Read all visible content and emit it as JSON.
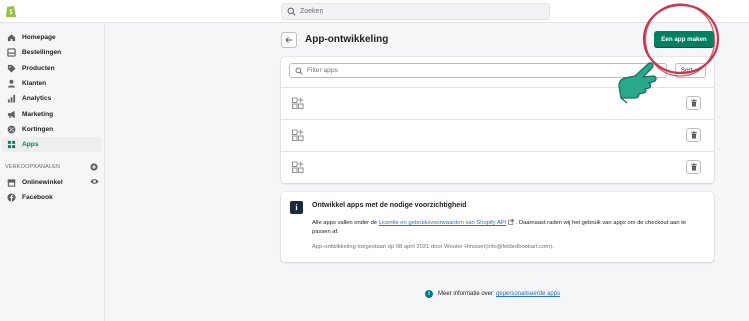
{
  "topbar": {
    "search_placeholder": "Zoeken"
  },
  "sidebar": {
    "items": [
      {
        "label": "Homepage",
        "icon": "home-icon"
      },
      {
        "label": "Bestellingen",
        "icon": "orders-icon"
      },
      {
        "label": "Producten",
        "icon": "tag-icon"
      },
      {
        "label": "Klanten",
        "icon": "person-icon"
      },
      {
        "label": "Analytics",
        "icon": "analytics-icon"
      },
      {
        "label": "Marketing",
        "icon": "megaphone-icon"
      },
      {
        "label": "Kortingen",
        "icon": "discount-icon"
      },
      {
        "label": "Apps",
        "icon": "apps-icon",
        "active": true
      }
    ],
    "section_title": "VERKOOPKANALEN",
    "channels": [
      {
        "label": "Onlinewinkel",
        "icon": "store-icon"
      },
      {
        "label": "Facebook",
        "icon": "facebook-icon"
      }
    ]
  },
  "page": {
    "title": "App-ontwikkeling",
    "primary_button": "Een app maken"
  },
  "apps_card": {
    "filter_placeholder": "Filter apps",
    "sort_label": "Sort",
    "rows": 3
  },
  "info_card": {
    "title": "Ontwikkel apps met de nodige voorzichtigheid",
    "body_prefix": "Alle apps vallen onder de ",
    "body_link": "Licentie en gebruiksvoorwaarden van Shopify API",
    "body_suffix": ". Daarnaast raden wij het gebruik van apps om de checkout aan te passen af.",
    "meta": "App-ontwikkeling toegestaan op 08 april 2021 door Wouter Hinssen(info@foldedbookart.com)."
  },
  "footer": {
    "prefix": "Meer informatie over",
    "link": "gepersonaliseerde apps"
  },
  "colors": {
    "primary": "#008060",
    "annotation_red": "#c8374f",
    "annotation_teal": "#2aa98a",
    "link": "#2c6ecb"
  }
}
